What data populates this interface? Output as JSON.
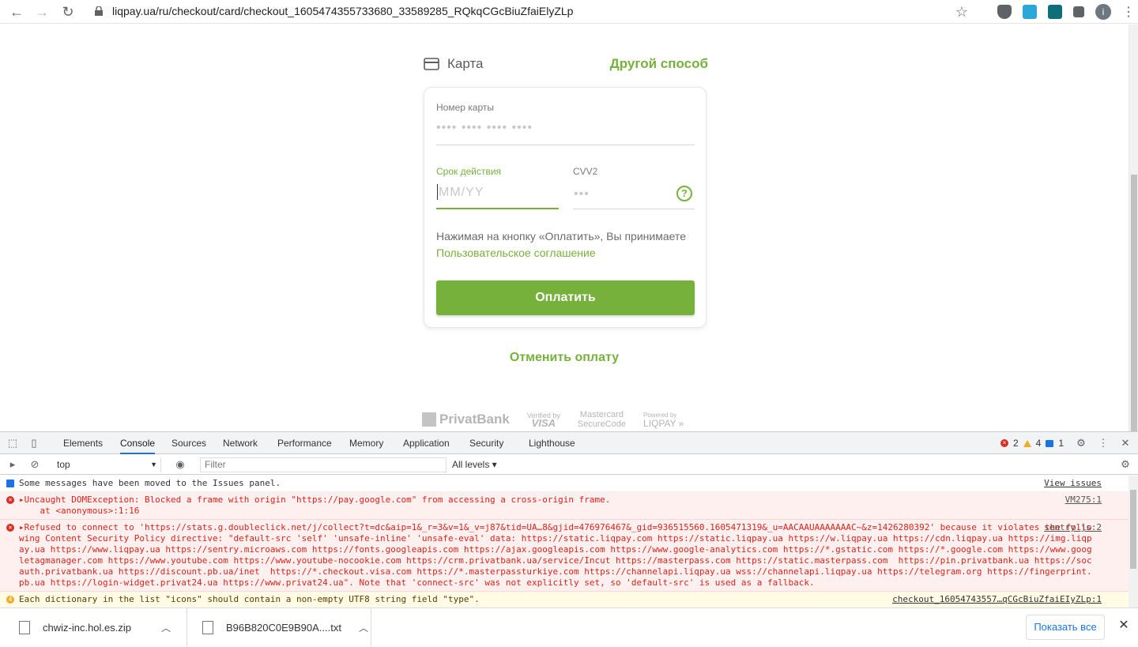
{
  "browser": {
    "url": "liqpay.ua/ru/checkout/card/checkout_1605474355733680_33589285_RQkqCGcBiuZfaiElyZLp"
  },
  "checkout": {
    "card_tab_label": "Карта",
    "other_method_label": "Другой способ",
    "card_number_label": "Номер карты",
    "card_number_placeholder": "•••• •••• •••• ••••",
    "expiry_label": "Срок действия",
    "expiry_placeholder": "MM/YY",
    "cvv_label": "CVV2",
    "cvv_placeholder": "•••",
    "help_icon_text": "?",
    "agreement_text": "Нажимая на кнопку «Оплатить», Вы принимаете",
    "agreement_link": "Пользовательское соглашение",
    "pay_button": "Оплатить",
    "cancel_label": "Отменить оплату"
  },
  "footer_logos": {
    "privatbank": "PrivatBank",
    "visa_top": "Verified by",
    "visa_bottom": "VISA",
    "mc_top": "Mastercard",
    "mc_bottom": "SecureCode",
    "liqpay_top": "Powered by",
    "liqpay_bottom": "LIQPAY »"
  },
  "devtools": {
    "tabs": [
      "Elements",
      "Console",
      "Sources",
      "Network",
      "Performance",
      "Memory",
      "Application",
      "Security",
      "Lighthouse"
    ],
    "active_tab": "Console",
    "error_count": "2",
    "warning_count": "4",
    "info_count": "1",
    "context": "top",
    "filter_placeholder": "Filter",
    "levels": "All levels ▾",
    "messages": [
      {
        "type": "info",
        "text": "Some messages have been moved to the Issues panel.",
        "source": "View issues"
      },
      {
        "type": "err",
        "text": "▸Uncaught DOMException: Blocked a frame with origin \"https://pay.google.com\" from accessing a cross-origin frame.\n    at <anonymous>:1:16",
        "source": "VM275:1"
      },
      {
        "type": "err",
        "text": "▸Refused to connect to 'https://stats.g.doubleclick.net/j/collect?t=dc&aip=1&_r=3&v=1&_v=j87&tid=UA…8&gjid=476976467&_gid=936515560.1605471319&_u=AACAAUAAAAAAAC~&z=1426280392' because it violates the following Content Security Policy directive: \"default-src 'self' 'unsafe-inline' 'unsafe-eval' data: https://static.liqpay.com https://static.liqpay.ua https://w.liqpay.ua https://cdn.liqpay.ua https://img.liqpay.ua https://www.liqpay.ua https://sentry.microaws.com https://fonts.googleapis.com https://ajax.googleapis.com https://www.google-analytics.com https://*.gstatic.com https://*.google.com https://www.googletagmanager.com https://www.youtube.com https://www.youtube-nocookie.com https://crm.privatbank.ua/service/Incut https://masterpass.com https://static.masterpass.com  https://pin.privatbank.ua https://socauth.privatbank.ua https://discount.pb.ua/inet  https://*.checkout.visa.com https://*.masterpassturkiye.com https://channelapi.liqpay.ua wss://channelapi.liqpay.ua https://telegram.org https://fingerprint.pb.ua https://login-widget.privat24.ua https://www.privat24.ua\". Note that 'connect-src' was not explicitly set, so 'default-src' is used as a fallback.",
        "source": "sentry.js:2"
      },
      {
        "type": "warn",
        "text": "Each dictionary in the list \"icons\" should contain a non-empty UTF8 string field \"type\".",
        "source": "checkout_16054743557…qCGcBiuZfaiEIyZLp:1",
        "badge": "4"
      }
    ]
  },
  "downloads": {
    "items": [
      "chwiz-inc.hol.es.zip",
      "B96B820C0E9B90A....txt"
    ],
    "show_all": "Показать все"
  }
}
